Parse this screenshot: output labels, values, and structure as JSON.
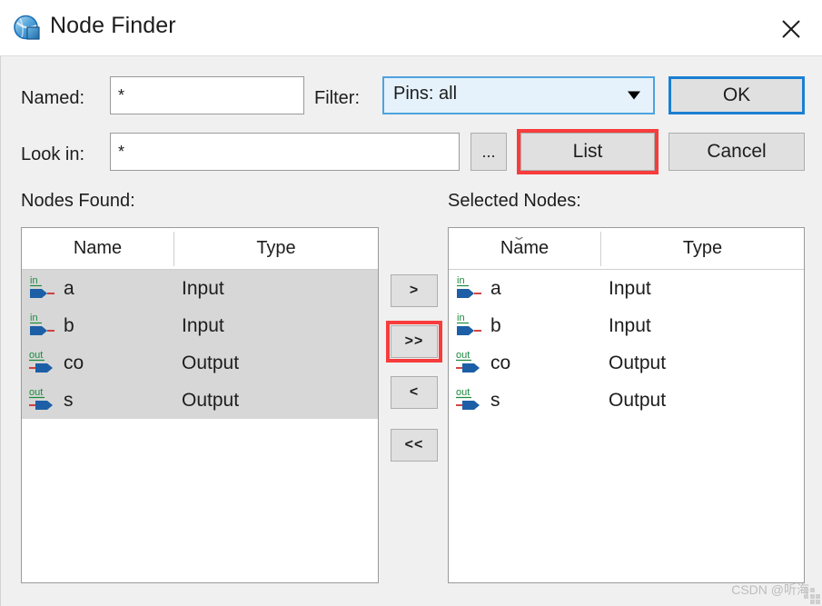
{
  "window": {
    "title": "Node Finder",
    "icon": "node-sphere-icon",
    "close_label": "✕"
  },
  "form": {
    "named_label": "Named:",
    "named_value": "*",
    "look_in_label": "Look in:",
    "look_in_value": "*",
    "browse_label": "...",
    "filter_label": "Filter:",
    "filter_value": "Pins: all"
  },
  "buttons": {
    "ok": "OK",
    "cancel": "Cancel",
    "list": "List"
  },
  "transfer": {
    "move_right": ">",
    "move_all_right": ">>",
    "move_left": "<",
    "move_all_left": "<<"
  },
  "nodes_found": {
    "title": "Nodes Found:",
    "columns": [
      "Name",
      "Type"
    ],
    "rows": [
      {
        "icon": "pin-in-icon",
        "name": "a",
        "type": "Input",
        "selected": true
      },
      {
        "icon": "pin-in-icon",
        "name": "b",
        "type": "Input",
        "selected": true
      },
      {
        "icon": "pin-out-icon",
        "name": "co",
        "type": "Output",
        "selected": true
      },
      {
        "icon": "pin-out-icon",
        "name": "s",
        "type": "Output",
        "selected": true
      }
    ]
  },
  "selected_nodes": {
    "title": "Selected Nodes:",
    "columns": [
      "Name",
      "Type"
    ],
    "sort_indicator": "⌄",
    "rows": [
      {
        "icon": "pin-in-icon",
        "name": "a",
        "type": "Input",
        "selected": false
      },
      {
        "icon": "pin-in-icon",
        "name": "b",
        "type": "Input",
        "selected": false
      },
      {
        "icon": "pin-out-icon",
        "name": "co",
        "type": "Output",
        "selected": false
      },
      {
        "icon": "pin-out-icon",
        "name": "s",
        "type": "Output",
        "selected": false
      }
    ]
  },
  "annotations": {
    "color": "#f73c3c",
    "targets": [
      "list-button",
      "move-all-right-button"
    ]
  },
  "watermark": {
    "text": "CSDN @听海"
  },
  "colors": {
    "accent_blue": "#1a7fd4",
    "combo_bg": "#e5f2fb",
    "combo_border": "#4ea3de",
    "selection_gray": "#d7d7d7",
    "dialog_bg": "#f0f0f0",
    "pin_blue": "#1d5fa6",
    "pin_green": "#1a8a3c",
    "pin_red": "#d03030"
  }
}
